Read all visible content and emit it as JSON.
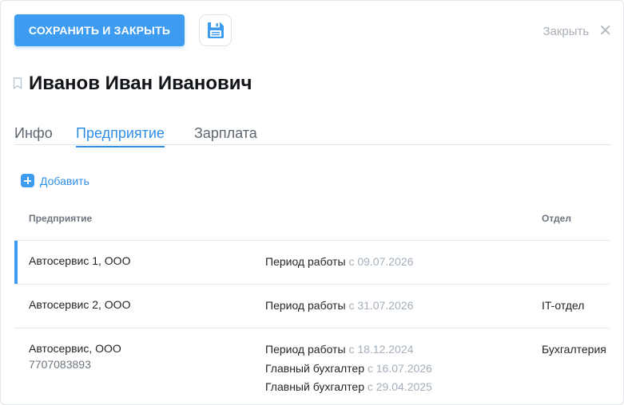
{
  "toolbar": {
    "save_close_label": "СОХРАНИТЬ И ЗАКРЫТЬ",
    "save_icon": "floppy-disk-icon",
    "close_label": "Закрыть",
    "close_icon": "close-icon"
  },
  "header": {
    "title": "Иванов Иван Иванович",
    "bookmark_icon": "bookmark-icon"
  },
  "tabs": [
    {
      "label": "Инфо",
      "active": false
    },
    {
      "label": "Предприятие",
      "active": true
    },
    {
      "label": "Зарплата",
      "active": false
    }
  ],
  "actions": {
    "add_label": "Добавить",
    "add_icon": "plus-icon"
  },
  "table": {
    "columns": [
      "Предприятие",
      "Отдел"
    ],
    "rows": [
      {
        "company": "Автосервис 1, ООО",
        "inn": "",
        "positions": [
          {
            "label": "Период работы",
            "since": "с 09.07.2026"
          }
        ],
        "department": "",
        "selected": true
      },
      {
        "company": "Автосервис 2, ООО",
        "inn": "",
        "positions": [
          {
            "label": "Период работы",
            "since": "с 31.07.2026"
          }
        ],
        "department": "IT-отдел",
        "selected": false
      },
      {
        "company": "Автосервис, ООО",
        "inn": "7707083893",
        "positions": [
          {
            "label": "Период работы",
            "since": "с 18.12.2024"
          },
          {
            "label": "Главный бухгалтер",
            "since": "с 16.07.2026"
          },
          {
            "label": "Главный бухгалтер",
            "since": "с 29.04.2025"
          }
        ],
        "department": "Бухгалтерия",
        "selected": false
      }
    ]
  },
  "colors": {
    "accent": "#3d9bf0",
    "muted_text": "#a3afbb"
  }
}
